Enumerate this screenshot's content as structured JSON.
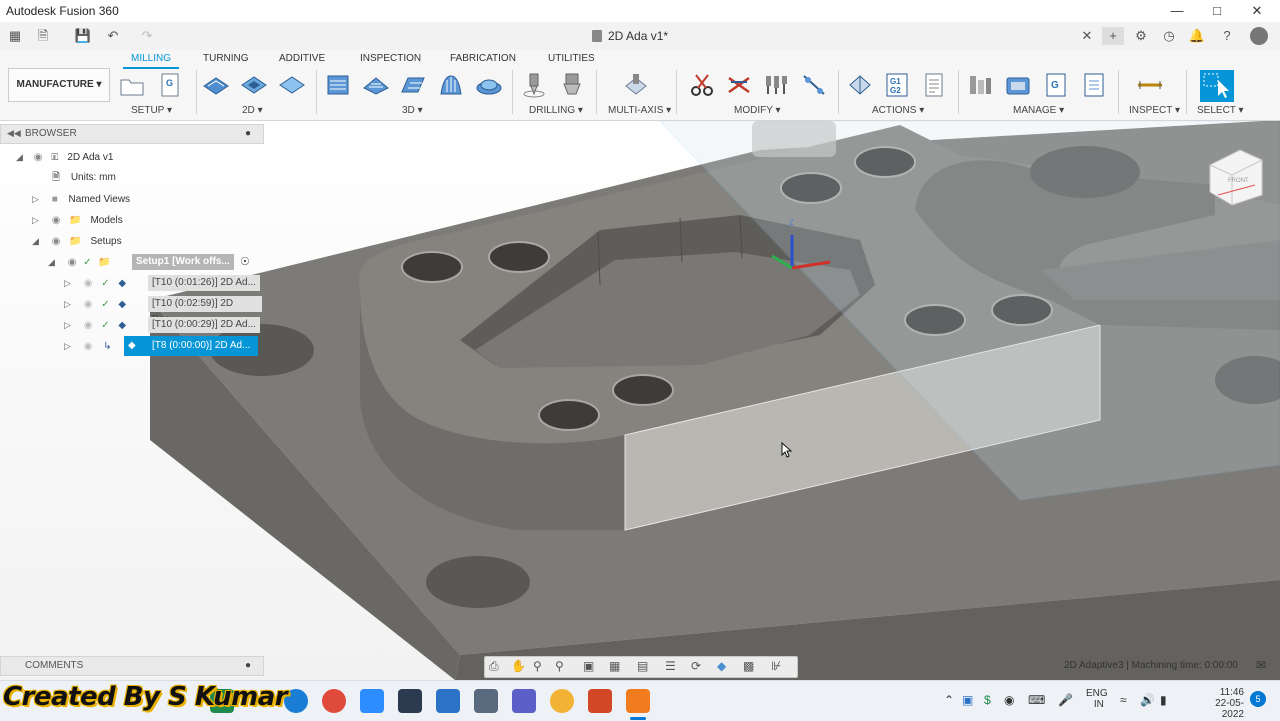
{
  "app": {
    "title": "Autodesk Fusion 360"
  },
  "document": {
    "tab_title": "2D Ada v1*"
  },
  "ribbon": {
    "tabs": [
      "MILLING",
      "TURNING",
      "ADDITIVE",
      "INSPECTION",
      "FABRICATION",
      "UTILITIES"
    ],
    "active_tab": "MILLING",
    "workspace": "MANUFACTURE",
    "groups": [
      "SETUP",
      "2D",
      "3D",
      "DRILLING",
      "MULTI-AXIS",
      "MODIFY",
      "ACTIONS",
      "MANAGE",
      "INSPECT",
      "SELECT"
    ]
  },
  "browser": {
    "title": "BROWSER",
    "root": "2D Ada v1",
    "units": "Units: mm",
    "named_views": "Named Views",
    "models": "Models",
    "setups": "Setups",
    "setup1": "Setup1 [Work offs...",
    "operations": [
      "[T10 (0:01:26)] 2D Ad...",
      "[T10 (0:02:59)] 2D Poc...",
      "[T10 (0:00:29)] 2D Ad...",
      "[T8 (0:00:00)] 2D Ad..."
    ]
  },
  "viewcube": {
    "face": "FRONT",
    "axis_label": "Z"
  },
  "comments": {
    "title": "COMMENTS"
  },
  "status": {
    "text": "2D Adaptive3 | Machining time: 0:00:00"
  },
  "taskbar": {
    "watermark": "Created By S Kumar",
    "lang_top": "ENG",
    "lang_bottom": "IN",
    "time": "11:46",
    "date": "22-05-2022",
    "notif_count": "5"
  },
  "colors": {
    "accent": "#0696d7",
    "model": "#7a7874",
    "model_dark": "#5f5d59",
    "model_light": "#9a9893"
  }
}
